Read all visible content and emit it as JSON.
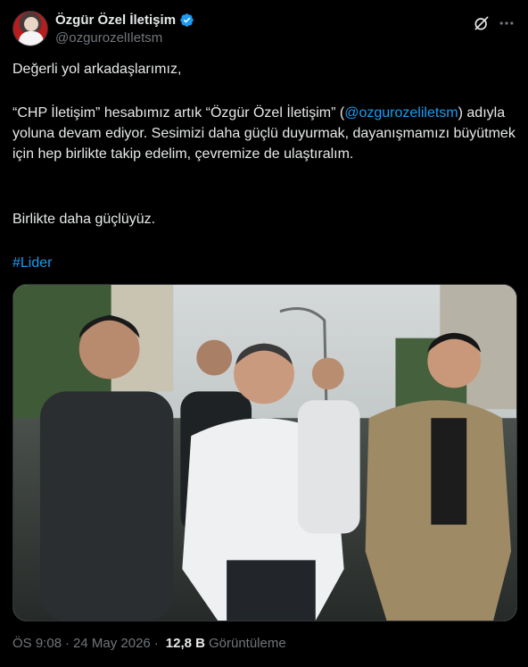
{
  "author": {
    "display_name": "Özgür Özel İletişim",
    "handle": "@ozgurozelIletsm",
    "verified": true,
    "avatar": "avatar-photo"
  },
  "header_icons": [
    "grok-icon",
    "more-icon"
  ],
  "tweet": {
    "greeting": "Değerli yol arkadaşlarımız,",
    "para2_before_mention": "“CHP İletişim” hesabımız artık “Özgür Özel İletişim” (",
    "mention": "@ozgurozeliletsm",
    "para2_after_mention": ") adıyla yoluna devam ediyor. Sesimizi daha güçlü duyurmak, dayanışmamızı büyütmek için hep birlikte takip edelim, çevremize de ulaştıralım.",
    "para3": "Birlikte daha güçlüyüz.",
    "hashtag": "#Lider"
  },
  "media": {
    "type": "photo"
  },
  "meta": {
    "time": "ÖS 9:08",
    "separator": "·",
    "date": "24 May 2026",
    "views_count": "12,8 B",
    "views_label": "Görüntüleme"
  },
  "colors": {
    "background": "#000000",
    "text": "#e7e9ea",
    "secondary": "#71767b",
    "accent": "#1d9bf0"
  }
}
